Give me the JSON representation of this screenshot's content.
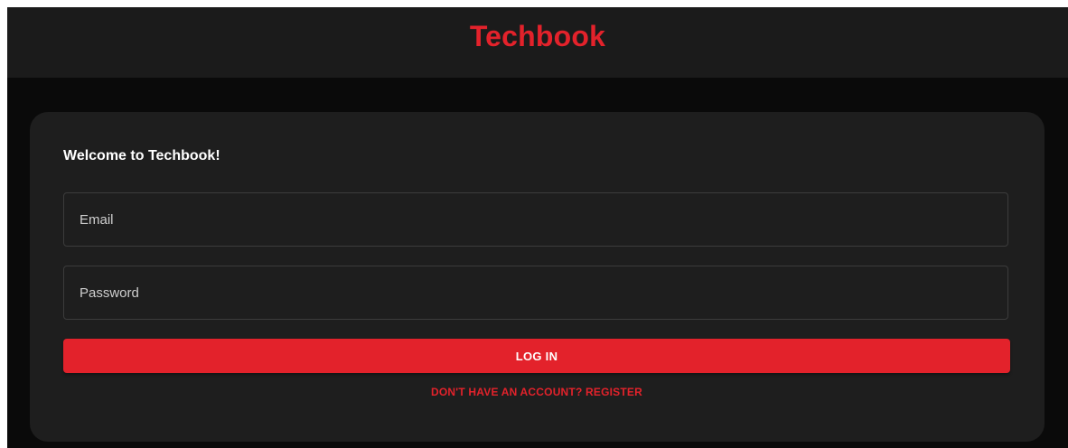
{
  "header": {
    "brand": "Techbook"
  },
  "login_card": {
    "welcome": "Welcome to Techbook!",
    "email": {
      "placeholder": "Email",
      "value": ""
    },
    "password": {
      "placeholder": "Password",
      "value": ""
    },
    "login_label": "LOG IN",
    "register_label": "DON'T HAVE AN ACCOUNT? REGISTER"
  },
  "colors": {
    "accent": "#e3222b",
    "header_bg": "#1b1b1b",
    "page_bg": "#0a0a0a",
    "card_bg": "#1e1e1e"
  }
}
